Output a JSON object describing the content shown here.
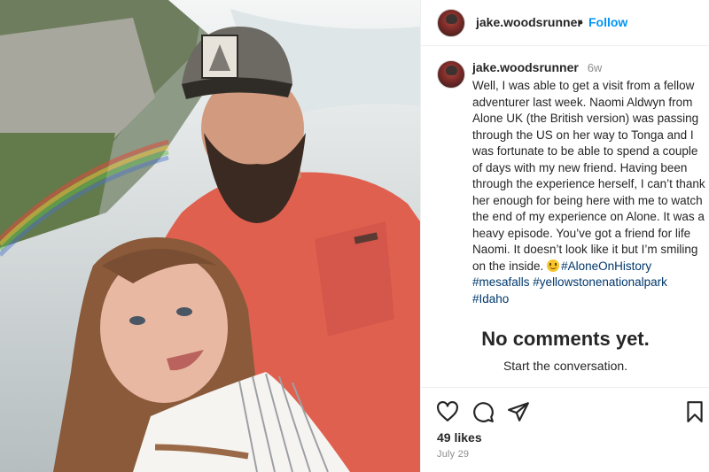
{
  "post": {
    "photo_alt": "Selfie of a bearded man in a cap and red shirt with a young woman in front of a waterfall with a rainbow",
    "header": {
      "username": "jake.woodsrunner",
      "separator": "•",
      "follow_label": "Follow"
    },
    "caption": {
      "username": "jake.woodsrunner",
      "time_ago": "6w",
      "text": "Well, I was able to get a visit from a fellow adventurer last week. Naomi Aldwyn from Alone UK (the British version) was passing through the US on her way to Tonga and I was fortunate to be able to spend a couple of days with my new friend. Having been through the experience herself, I can’t thank her enough for being here with me to watch the end of my experience on Alone. It was a heavy episode. You’ve got a friend for life Naomi. It doesn’t look like it but I’m smiling on the inside.",
      "emoji": "smiling-face-emoji",
      "hashtags": [
        "#AloneOnHistory",
        "#mesafalls",
        "#yellowstonenationalpark",
        "#Idaho"
      ]
    },
    "comments": {
      "empty_title": "No comments yet.",
      "empty_subtitle": "Start the conversation."
    },
    "actions": {
      "icons": [
        "heart-icon",
        "comment-icon",
        "share-icon",
        "bookmark-icon"
      ],
      "likes": "49 likes",
      "date": "July 29"
    },
    "colors": {
      "link_blue": "#0095f6",
      "hashtag": "#00376b",
      "muted": "#8e8e8e",
      "text": "#262626"
    }
  }
}
